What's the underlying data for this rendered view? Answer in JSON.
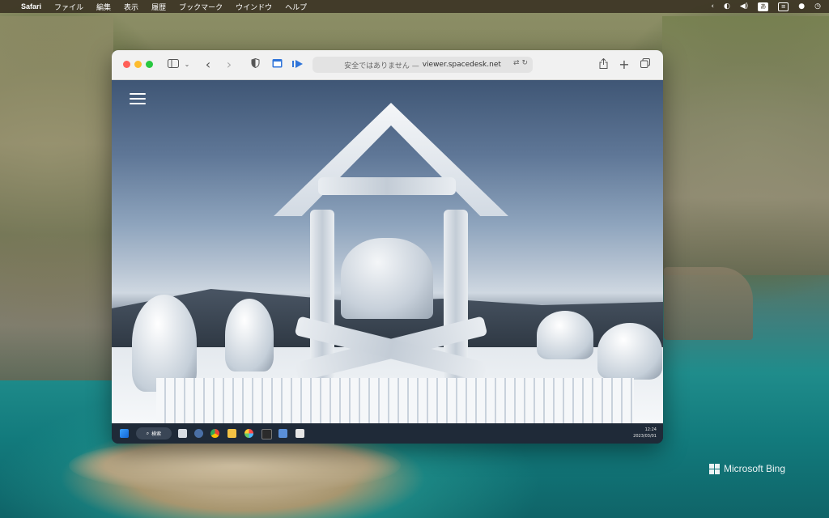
{
  "menubar": {
    "apple_glyph": "",
    "app_name": "Safari",
    "items": [
      "ファイル",
      "編集",
      "表示",
      "履歴",
      "ブックマーク",
      "ウインドウ",
      "ヘルプ"
    ],
    "input_method": "あ"
  },
  "browser": {
    "url_prefix": "安全ではありません —",
    "url": "viewer.spacedesk.net",
    "icons": {
      "sidebar": "sidebar-icon",
      "back": "‹",
      "forward": "›",
      "share": "share-icon",
      "new_tab": "+",
      "tabs": "tabs-icon"
    }
  },
  "taskbar": {
    "search_label": "検索",
    "time": "12:24",
    "date": "2023/03/01"
  },
  "watermark": {
    "text": "Microsoft Bing"
  },
  "colors": {
    "close": "#ff5f57",
    "minimize": "#febc2e",
    "zoom": "#28c840",
    "taskbar": "#1f2a38",
    "menubar": "#3c3424"
  }
}
